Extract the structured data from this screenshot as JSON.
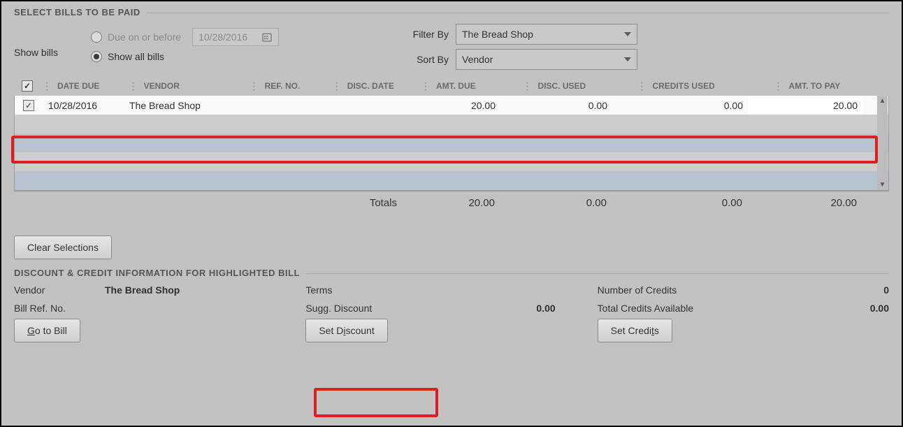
{
  "sections": {
    "select_bills": "SELECT BILLS TO BE PAID",
    "discount_info": "DISCOUNT & CREDIT INFORMATION FOR HIGHLIGHTED BILL"
  },
  "filters": {
    "show_bills_label": "Show bills",
    "radio_due_label": "Due on or before",
    "radio_all_label": "Show all bills",
    "date_disabled": "10/28/2016",
    "filter_by_label": "Filter By",
    "sort_by_label": "Sort By",
    "filter_by_value": "The Bread Shop",
    "sort_by_value": "Vendor"
  },
  "table": {
    "headers": {
      "date_due": "DATE DUE",
      "vendor": "VENDOR",
      "ref_no": "REF. NO.",
      "disc_date": "DISC. DATE",
      "amt_due": "AMT. DUE",
      "disc_used": "DISC. USED",
      "credits_used": "CREDITS USED",
      "amt_to_pay": "AMT. TO PAY"
    },
    "rows": [
      {
        "checked": true,
        "date_due": "10/28/2016",
        "vendor": "The Bread Shop",
        "ref_no": "",
        "disc_date": "",
        "amt_due": "20.00",
        "disc_used": "0.00",
        "credits_used": "0.00",
        "amt_to_pay": "20.00"
      }
    ],
    "totals_label": "Totals",
    "totals": {
      "amt_due": "20.00",
      "disc_used": "0.00",
      "credits_used": "0.00",
      "amt_to_pay": "20.00"
    }
  },
  "buttons": {
    "clear_selections": "Clear Selections",
    "go_to_bill": "Go to Bill",
    "set_discount": "Set Discount",
    "set_credits": "Set Credits"
  },
  "info": {
    "vendor_label": "Vendor",
    "vendor_value": "The Bread Shop",
    "bill_ref_label": "Bill Ref. No.",
    "bill_ref_value": "",
    "terms_label": "Terms",
    "terms_value": "",
    "sugg_discount_label": "Sugg. Discount",
    "sugg_discount_value": "0.00",
    "num_credits_label": "Number of Credits",
    "num_credits_value": "0",
    "total_credits_label": "Total Credits Available",
    "total_credits_value": "0.00"
  }
}
